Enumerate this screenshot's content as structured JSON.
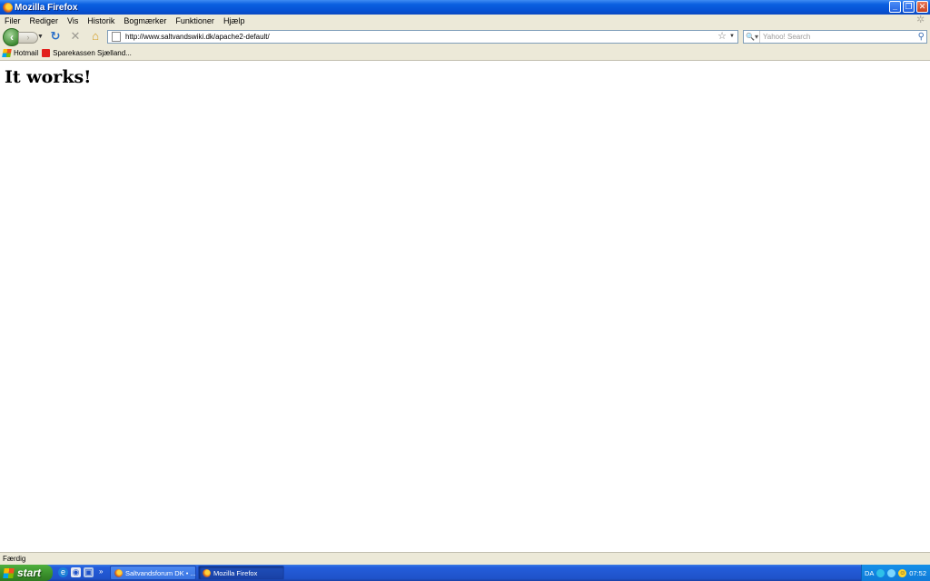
{
  "window": {
    "title": "Mozilla Firefox"
  },
  "menu": [
    "Filer",
    "Rediger",
    "Vis",
    "Historik",
    "Bogmærker",
    "Funktioner",
    "Hjælp"
  ],
  "navigation": {
    "url": "http://www.saltvandswiki.dk/apache2-default/",
    "search_placeholder": "Yahoo! Search"
  },
  "bookmarks": [
    {
      "label": "Hotmail",
      "icon": "msn-butterfly-icon"
    },
    {
      "label": "Sparekassen Sjælland...",
      "icon": "sparekassen-icon"
    }
  ],
  "content": {
    "heading": "It works!"
  },
  "status": {
    "text": "Færdig"
  },
  "taskbar": {
    "start_label": "start",
    "tasks": [
      {
        "label": "Saltvandsforum DK • ..."
      },
      {
        "label": "Mozilla Firefox"
      }
    ],
    "tray": {
      "language": "DA",
      "clock": "07:52"
    }
  },
  "colors": {
    "titlebar": "#0653d6",
    "chrome": "#ece9d8",
    "start_button": "#3a8f2b",
    "taskbar": "#245edb"
  }
}
